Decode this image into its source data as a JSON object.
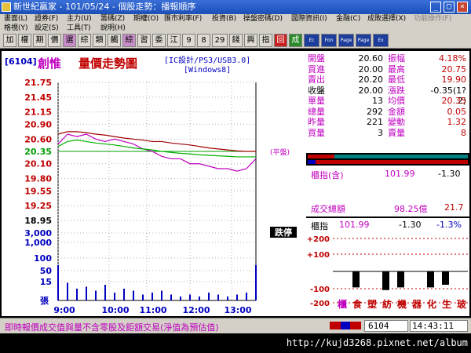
{
  "window": {
    "title": "新世紀贏家 - 101/05/24 - 個股走勢：播報順序"
  },
  "menu": {
    "row1": [
      "畫面(L)",
      "證券(F)",
      "主力(U)",
      "籌碼(Z)",
      "期權(O)",
      "匯市利率(F)",
      "投資(B)",
      "操盤密碼(D)",
      "國際資訊(I)",
      "金融(C)",
      "成敗選擇(X)",
      "功能操作(F)"
    ],
    "row2": [
      "格視(Y)",
      "設定(S)",
      "工具(T)",
      "說明(H)"
    ]
  },
  "toolbar": {
    "buttons": [
      "加",
      "權",
      "期",
      "價",
      "選",
      "綜",
      "類",
      "觸",
      "綜",
      "習",
      "委",
      "江",
      "9",
      "8",
      "29",
      "錢",
      "興",
      "指",
      "回",
      "成",
      "Ec",
      "Fon",
      "Page",
      "Page",
      "Ex"
    ]
  },
  "stock": {
    "code": "[6104]",
    "name": "創惟",
    "chart_title": "量價走勢圖",
    "tags_line1": "[IC設計/PS3/USB3.0]",
    "tags_line2": "[Windows8]"
  },
  "price_labels": [
    "21.75",
    "21.45",
    "21.15",
    "20.90",
    "20.60",
    "20.35",
    "20.10",
    "19.80",
    "19.55",
    "19.25",
    "18.95"
  ],
  "volume_labels": [
    "3,000",
    "1,000",
    "100",
    "50",
    "15"
  ],
  "volume_unit": "張",
  "time_labels": [
    "9:00",
    "10:00",
    "11:00",
    "12:00",
    "13:00"
  ],
  "annotations": {
    "flat_label": "(平盤)",
    "limit_down": "跌停"
  },
  "chart_data": {
    "type": "line",
    "x": [
      "09:00",
      "09:10",
      "09:20",
      "09:30",
      "09:40",
      "09:50",
      "10:00",
      "10:15",
      "10:30",
      "10:45",
      "11:00",
      "11:15",
      "11:30",
      "11:45",
      "12:00",
      "12:15",
      "12:30",
      "12:45",
      "13:00",
      "13:10",
      "13:20",
      "13:30"
    ],
    "series": [
      {
        "name": "price",
        "values": [
          20.5,
          20.7,
          20.65,
          20.7,
          20.6,
          20.55,
          20.6,
          20.55,
          20.5,
          20.4,
          20.35,
          20.25,
          20.2,
          20.2,
          20.1,
          20.1,
          20.05,
          20.0,
          20.0,
          19.95,
          20.0,
          20.2
        ]
      },
      {
        "name": "avg",
        "values": [
          20.45,
          20.55,
          20.58,
          20.55,
          20.52,
          20.5,
          20.48,
          20.45,
          20.42,
          20.4,
          20.38,
          20.35,
          20.33,
          20.31,
          20.3,
          20.28,
          20.27,
          20.26,
          20.25,
          20.24,
          20.24,
          20.24
        ]
      },
      {
        "name": "index",
        "values": [
          20.7,
          20.75,
          20.75,
          20.73,
          20.7,
          20.68,
          20.65,
          20.62,
          20.6,
          20.58,
          20.55,
          20.55,
          20.52,
          20.5,
          20.48,
          20.45,
          20.42,
          20.4,
          20.38,
          20.36,
          20.35,
          20.35
        ]
      }
    ],
    "volume": [
      18,
      9,
      6,
      7,
      5,
      8,
      4,
      6,
      5,
      3,
      4,
      5,
      3,
      2,
      3,
      2,
      4,
      3,
      2,
      3,
      4,
      18
    ],
    "ylim": [
      18.95,
      21.75
    ],
    "reference": 20.35
  },
  "quote": {
    "rows": [
      {
        "l1": "開盤",
        "v1": "20.60",
        "l2": "振幅",
        "v2": "4.18%"
      },
      {
        "l1": "買進",
        "v1": "20.00",
        "l2": "最高",
        "v2": "20.75"
      },
      {
        "l1": "賣出",
        "v1": "20.20",
        "l2": "最低",
        "v2": "19.90"
      },
      {
        "l1": "收盤",
        "v1": "20.00",
        "l2": "漲跌",
        "v2": "-0.35(1?2)"
      },
      {
        "l1": "單量",
        "v1": "13",
        "l2": "均價",
        "v2": "20.35"
      },
      {
        "l1": "總量",
        "v1": "292",
        "l2": "金額",
        "v2": "0.05"
      },
      {
        "l1": "昨量",
        "v1": "221",
        "l2": "變動",
        "v2": "1.32"
      },
      {
        "l1": "買量",
        "v1": "3",
        "l2": "賣量",
        "v2": "8"
      }
    ],
    "index_row": {
      "label": "櫃指(含)",
      "value": "101.99",
      "change": "-1.30"
    },
    "turnover": {
      "label": "成交總額",
      "value": "98.25億",
      "extra": "21.7"
    },
    "index_summary": {
      "label": "櫃指",
      "value": "101.99",
      "change": "-1.30",
      "pct": "-1.3%"
    },
    "sector_axis": [
      "+200",
      "+100",
      "-100",
      "-200"
    ],
    "sectors": [
      "櫃",
      "食",
      "塑",
      "紡",
      "機",
      "器",
      "化",
      "生",
      "玻"
    ],
    "sector_values": [
      0,
      -60,
      0,
      -70,
      -60,
      0,
      -60,
      -50,
      0
    ]
  },
  "status": {
    "message": "即時報價成交值與量不含零股及鉅額交易(淨值為預估值)",
    "code": "6104",
    "clock": "14:43:11"
  },
  "watermark": "http://kujd3268.pixnet.net/album",
  "colors": {
    "price": "#c000c0",
    "avg": "#00b000",
    "index": "#a00000",
    "volume": "#0000c0",
    "up": "#c00000",
    "down": "#008000"
  }
}
